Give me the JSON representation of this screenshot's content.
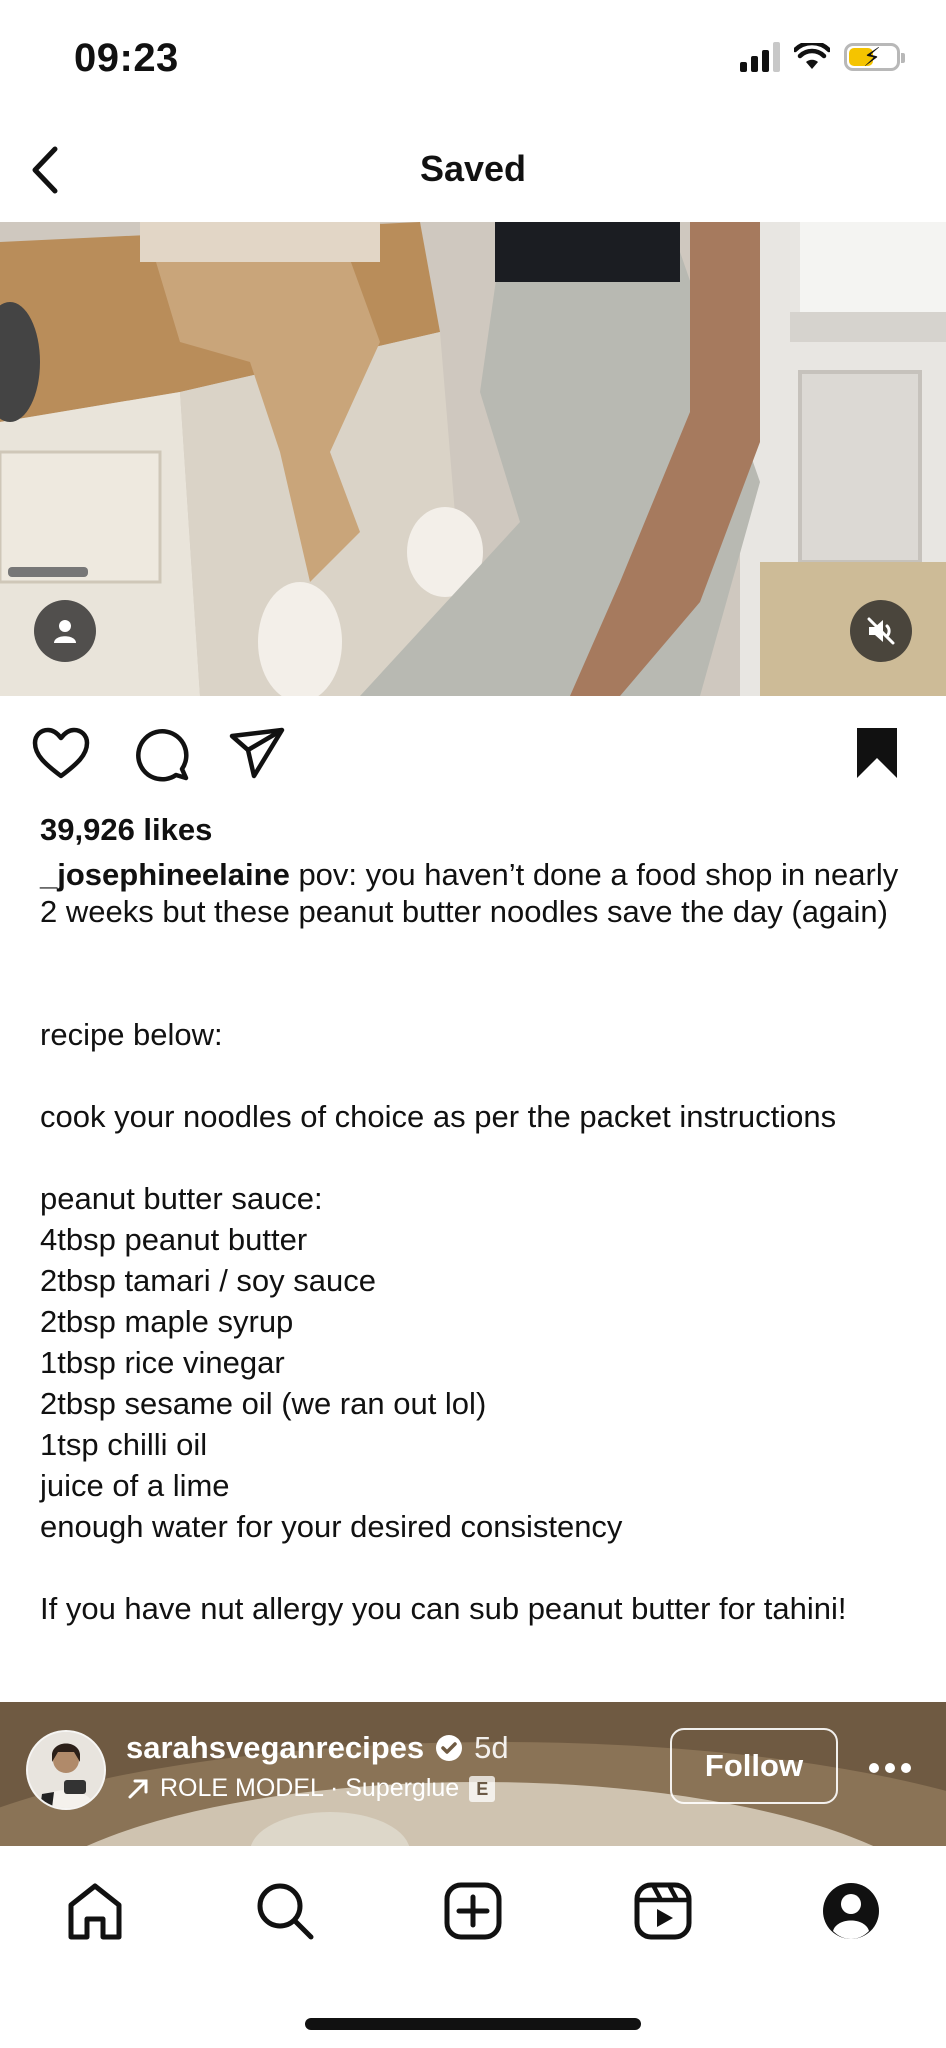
{
  "status_bar": {
    "time": "09:23",
    "battery_level": 0.55,
    "battery_color": "#f5c400",
    "icons": [
      "signal-icon",
      "wifi-icon",
      "battery-charging-icon"
    ]
  },
  "header": {
    "title": "Saved",
    "back_icon": "chevron-left-icon"
  },
  "post": {
    "media_icons": [
      "person-tag-icon",
      "muted-speaker-icon"
    ],
    "actions": [
      "heart-icon",
      "comment-icon",
      "share-icon",
      "bookmark-filled-icon"
    ],
    "likes": "39,926 likes",
    "caption_user": "_josephineelaine",
    "caption_text": " pov: you haven’t done a food shop in nearly 2 weeks but these peanut butter noodles save the day (again)",
    "recipe_lines": [
      "recipe below:",
      "",
      "cook your noodles of choice as per the packet instructions",
      "",
      "peanut butter sauce:",
      "4tbsp peanut butter",
      "2tbsp tamari / soy sauce",
      "2tbsp maple syrup",
      "1tbsp rice vinegar",
      "2tbsp sesame oil (we ran out lol)",
      "1tsp chilli oil",
      "juice of a lime",
      "enough water for your desired consistency",
      "",
      "If you have nut allergy you can sub peanut butter for tahini!"
    ]
  },
  "next_post": {
    "username": "sarahsveganrecipes",
    "time_ago": "5d",
    "audio": "ROLE MODEL · Superglue",
    "explicit_badge": "E",
    "follow_label": "Follow",
    "verified_icon": "verified-badge-icon",
    "more_icon": "more-horizontal-icon"
  },
  "tab_bar": {
    "tabs": [
      "home-icon",
      "search-icon",
      "create-icon",
      "reels-icon",
      "profile-icon"
    ]
  }
}
